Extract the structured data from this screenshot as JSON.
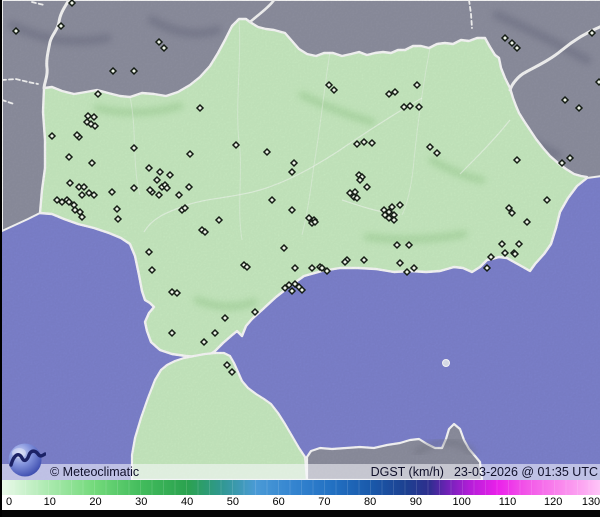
{
  "footer": {
    "copyright": "© Meteoclimatic",
    "product_label": "DGST (km/h)",
    "datetime": "23-03-2026 @ 01:35 UTC"
  },
  "logo": {
    "name": "meteoclimatic-logo"
  },
  "legend": {
    "unit": "km/h",
    "ticks": [
      0,
      10,
      20,
      30,
      40,
      50,
      60,
      70,
      80,
      90,
      100,
      110,
      120,
      130
    ],
    "gradient_stops": [
      {
        "v": 0,
        "pos": 0.5,
        "color": "#e6f8e6"
      },
      {
        "v": 10,
        "pos": 8.0,
        "color": "#a9e9ad"
      },
      {
        "v": 20,
        "pos": 15.6,
        "color": "#72d97a"
      },
      {
        "v": 30,
        "pos": 23.2,
        "color": "#42bc5c"
      },
      {
        "v": 40,
        "pos": 30.9,
        "color": "#2ba24f"
      },
      {
        "v": 47,
        "pos": 36.2,
        "color": "#2f988c"
      },
      {
        "v": 55,
        "pos": 42.3,
        "color": "#4a9ad6"
      },
      {
        "v": 63,
        "pos": 48.4,
        "color": "#3585d0"
      },
      {
        "v": 72,
        "pos": 55.2,
        "color": "#2270c2"
      },
      {
        "v": 80,
        "pos": 61.3,
        "color": "#1a5aab"
      },
      {
        "v": 88,
        "pos": 67.4,
        "color": "#1d4090"
      },
      {
        "v": 93,
        "pos": 71.2,
        "color": "#2e2e8e"
      },
      {
        "v": 97,
        "pos": 74.2,
        "color": "#6e22b6"
      },
      {
        "v": 102,
        "pos": 78.0,
        "color": "#b41ed8"
      },
      {
        "v": 108,
        "pos": 82.6,
        "color": "#ea20ea"
      },
      {
        "v": 114,
        "pos": 87.2,
        "color": "#f254e8"
      },
      {
        "v": 121,
        "pos": 92.5,
        "color": "#f982ec"
      },
      {
        "v": 127,
        "pos": 97.1,
        "color": "#fcaaf2"
      },
      {
        "v": 130,
        "pos": 100,
        "color": "#ffc8f8"
      }
    ]
  },
  "map": {
    "colors": {
      "sea": "#7e83cf",
      "neighbor_land": "#8e90a0",
      "region_land": "#c9ecc2",
      "coast_border": "#fafafa",
      "marker_stroke": "#151d15",
      "marker_fill": "#eef4e8"
    },
    "stations": [
      [
        70,
        3
      ],
      [
        59,
        26
      ],
      [
        14,
        31
      ],
      [
        157,
        42
      ],
      [
        162,
        48
      ],
      [
        111,
        71
      ],
      [
        132,
        71
      ],
      [
        96,
        94
      ],
      [
        198,
        108
      ],
      [
        503,
        38
      ],
      [
        510,
        43
      ],
      [
        515,
        48
      ],
      [
        590,
        33
      ],
      [
        563,
        100
      ],
      [
        577,
        108
      ],
      [
        597,
        82
      ],
      [
        568,
        158
      ],
      [
        560,
        163
      ],
      [
        327,
        85
      ],
      [
        332,
        90
      ],
      [
        387,
        94
      ],
      [
        393,
        92
      ],
      [
        402,
        107
      ],
      [
        408,
        106
      ],
      [
        415,
        85
      ],
      [
        417,
        107
      ],
      [
        428,
        147
      ],
      [
        435,
        153
      ],
      [
        515,
        160
      ],
      [
        507,
        208
      ],
      [
        510,
        213
      ],
      [
        86,
        116
      ],
      [
        92,
        117
      ],
      [
        85,
        122
      ],
      [
        89,
        124
      ],
      [
        93,
        126
      ],
      [
        77,
        137
      ],
      [
        50,
        136
      ],
      [
        75,
        135
      ],
      [
        67,
        157
      ],
      [
        90,
        163
      ],
      [
        132,
        148
      ],
      [
        188,
        154
      ],
      [
        234,
        145
      ],
      [
        147,
        168
      ],
      [
        155,
        180
      ],
      [
        158,
        172
      ],
      [
        160,
        187
      ],
      [
        163,
        185
      ],
      [
        165,
        188
      ],
      [
        168,
        175
      ],
      [
        157,
        195
      ],
      [
        150,
        192
      ],
      [
        148,
        190
      ],
      [
        132,
        188
      ],
      [
        110,
        192
      ],
      [
        177,
        195
      ],
      [
        187,
        187
      ],
      [
        180,
        210
      ],
      [
        183,
        208
      ],
      [
        200,
        230
      ],
      [
        203,
        232
      ],
      [
        217,
        220
      ],
      [
        68,
        183
      ],
      [
        77,
        187
      ],
      [
        82,
        187
      ],
      [
        87,
        193
      ],
      [
        80,
        195
      ],
      [
        92,
        195
      ],
      [
        65,
        200
      ],
      [
        55,
        200
      ],
      [
        60,
        202
      ],
      [
        67,
        202
      ],
      [
        72,
        205
      ],
      [
        73,
        210
      ],
      [
        78,
        212
      ],
      [
        80,
        217
      ],
      [
        115,
        209
      ],
      [
        116,
        219
      ],
      [
        355,
        144
      ],
      [
        362,
        142
      ],
      [
        370,
        143
      ],
      [
        265,
        152
      ],
      [
        292,
        163
      ],
      [
        290,
        172
      ],
      [
        357,
        175
      ],
      [
        360,
        177
      ],
      [
        358,
        180
      ],
      [
        365,
        187
      ],
      [
        348,
        193
      ],
      [
        353,
        192
      ],
      [
        352,
        197
      ],
      [
        355,
        198
      ],
      [
        270,
        200
      ],
      [
        290,
        210
      ],
      [
        398,
        205
      ],
      [
        382,
        210
      ],
      [
        387,
        212
      ],
      [
        390,
        207
      ],
      [
        392,
        215
      ],
      [
        383,
        215
      ],
      [
        387,
        218
      ],
      [
        392,
        220
      ],
      [
        307,
        218
      ],
      [
        312,
        220
      ],
      [
        310,
        223
      ],
      [
        313,
        222
      ],
      [
        282,
        248
      ],
      [
        395,
        245
      ],
      [
        407,
        245
      ],
      [
        242,
        265
      ],
      [
        245,
        267
      ],
      [
        293,
        268
      ],
      [
        310,
        268
      ],
      [
        318,
        267
      ],
      [
        320,
        268
      ],
      [
        345,
        260
      ],
      [
        362,
        260
      ],
      [
        398,
        263
      ],
      [
        412,
        268
      ],
      [
        325,
        271
      ],
      [
        343,
        262
      ],
      [
        405,
        272
      ],
      [
        287,
        285
      ],
      [
        293,
        284
      ],
      [
        297,
        287
      ],
      [
        300,
        290
      ],
      [
        290,
        291
      ],
      [
        283,
        288
      ],
      [
        253,
        312
      ],
      [
        170,
        292
      ],
      [
        223,
        318
      ],
      [
        213,
        333
      ],
      [
        202,
        342
      ],
      [
        147,
        252
      ],
      [
        150,
        270
      ],
      [
        175,
        293
      ],
      [
        170,
        333
      ],
      [
        489,
        257
      ],
      [
        500,
        244
      ],
      [
        503,
        253
      ],
      [
        512,
        253
      ],
      [
        517,
        244
      ],
      [
        513,
        254
      ],
      [
        485,
        268
      ],
      [
        525,
        222
      ],
      [
        545,
        200
      ],
      [
        225,
        365
      ],
      [
        230,
        372
      ]
    ]
  }
}
